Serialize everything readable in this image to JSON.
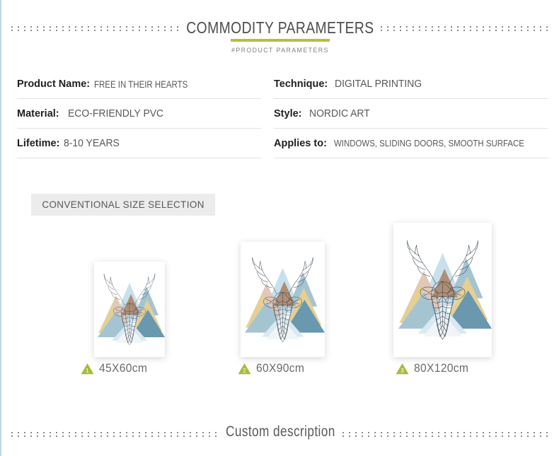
{
  "header": {
    "title": "COMMODITY PARAMETERS",
    "subtitle": "#PRODUCT PARAMETERS",
    "accent_color": "#b6bd45"
  },
  "parameters": {
    "left": [
      {
        "label": "Product Name:",
        "value": "FREE IN THEIR HEARTS"
      },
      {
        "label": "Material:",
        "value": "ECO-FRIENDLY PVC"
      },
      {
        "label": "Lifetime:",
        "value": "8-10 YEARS"
      }
    ],
    "right": [
      {
        "label": "Technique:",
        "value": "DIGITAL PRINTING"
      },
      {
        "label": "Style:",
        "value": "NORDIC ART"
      },
      {
        "label": "Applies to:",
        "value": "WINDOWS, SLIDING DOORS, SMOOTH SURFACE"
      }
    ]
  },
  "size_section": {
    "tag": "CONVENTIONAL SIZE SELECTION",
    "badge_color": "#a8bb3a",
    "options": [
      {
        "number": "1",
        "size": "45X60cm"
      },
      {
        "number": "2",
        "size": "60X90cm"
      },
      {
        "number": "3",
        "size": "80X120cm"
      }
    ]
  },
  "artwork": {
    "name": "geometric-deer-head-poster",
    "palette": {
      "light_blue": "#b9d8e8",
      "pale_blue": "#cfe4ee",
      "steel_blue": "#8db4c6",
      "deep_teal": "#3f7c99",
      "tan": "#d9b9a3",
      "gold": "#e0c274",
      "brown": "#9b6f4e",
      "mist": "#eef3f5",
      "line": "#3d4a55"
    }
  },
  "footer": {
    "title": "Custom description"
  }
}
